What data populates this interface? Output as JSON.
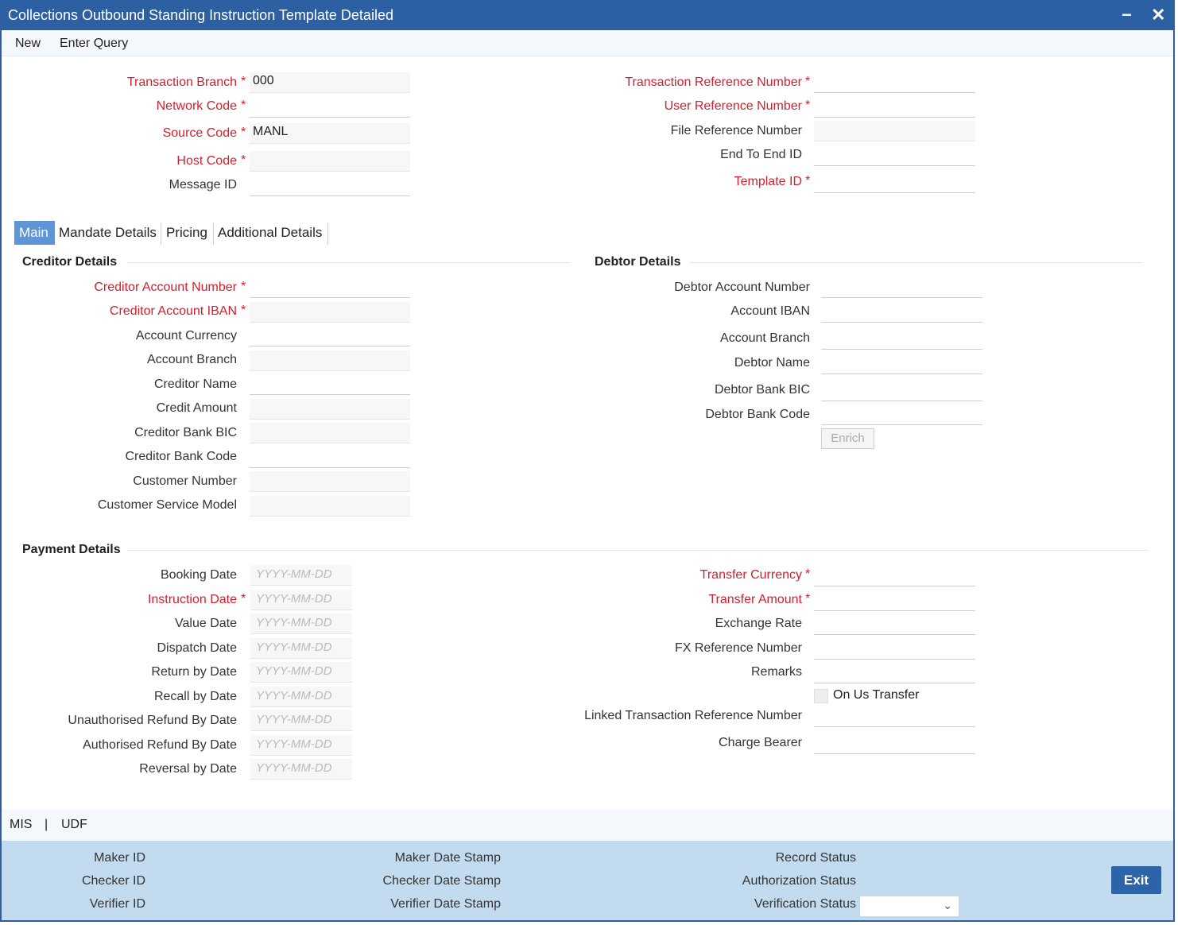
{
  "window": {
    "title": "Collections Outbound Standing Instruction Template Detailed",
    "minimize": "−",
    "close": "✕"
  },
  "toolbar": {
    "new": "New",
    "enter_query": "Enter Query"
  },
  "header": {
    "transaction_branch": {
      "label": "Transaction Branch",
      "value": "000"
    },
    "network_code": {
      "label": "Network Code",
      "value": ""
    },
    "source_code": {
      "label": "Source Code",
      "value": "MANL"
    },
    "host_code": {
      "label": "Host Code",
      "value": ""
    },
    "message_id": {
      "label": "Message ID",
      "value": ""
    },
    "transaction_reference_number": {
      "label": "Transaction Reference Number",
      "value": ""
    },
    "user_reference_number": {
      "label": "User Reference Number",
      "value": ""
    },
    "file_reference_number": {
      "label": "File Reference Number",
      "value": ""
    },
    "end_to_end_id": {
      "label": "End To End ID",
      "value": ""
    },
    "template_id": {
      "label": "Template ID",
      "value": ""
    }
  },
  "required_mark": "*",
  "tabs": {
    "main": "Main",
    "mandate": "Mandate Details",
    "pricing": "Pricing",
    "additional": "Additional Details"
  },
  "creditor": {
    "section_title": "Creditor Details",
    "account_number": "Creditor Account Number",
    "account_iban": "Creditor Account IBAN",
    "account_currency": "Account Currency",
    "account_branch": "Account Branch",
    "name": "Creditor Name",
    "credit_amount": "Credit Amount",
    "bank_bic": "Creditor Bank BIC",
    "bank_code": "Creditor Bank Code",
    "customer_number": "Customer Number",
    "customer_service_model": "Customer Service Model"
  },
  "debtor": {
    "section_title": "Debtor Details",
    "account_number": "Debtor Account Number",
    "account_iban": "Account IBAN",
    "account_branch": "Account Branch",
    "name": "Debtor Name",
    "bank_bic": "Debtor Bank BIC",
    "bank_code": "Debtor Bank Code",
    "enrich": "Enrich"
  },
  "payment": {
    "section_title": "Payment Details",
    "date_placeholder": "YYYY-MM-DD",
    "booking_date": "Booking Date",
    "instruction_date": "Instruction Date",
    "value_date": "Value Date",
    "dispatch_date": "Dispatch Date",
    "return_by_date": "Return by Date",
    "recall_by_date": "Recall by Date",
    "unauthorised_refund_by_date": "Unauthorised Refund By Date",
    "authorised_refund_by_date": "Authorised Refund By Date",
    "reversal_by_date": "Reversal by Date",
    "transfer_currency": "Transfer Currency",
    "transfer_amount": "Transfer Amount",
    "exchange_rate": "Exchange Rate",
    "fx_reference_number": "FX Reference Number",
    "remarks": "Remarks",
    "on_us_transfer": "On Us Transfer",
    "linked_transaction_reference_number": "Linked Transaction Reference Number",
    "charge_bearer": "Charge Bearer"
  },
  "links": {
    "mis": "MIS",
    "separator": "|",
    "udf": "UDF"
  },
  "footer": {
    "maker_id": "Maker ID",
    "checker_id": "Checker ID",
    "verifier_id": "Verifier ID",
    "maker_date_stamp": "Maker Date Stamp",
    "checker_date_stamp": "Checker Date Stamp",
    "verifier_date_stamp": "Verifier Date Stamp",
    "record_status": "Record Status",
    "authorization_status": "Authorization Status",
    "verification_status": "Verification Status",
    "exit": "Exit"
  },
  "colors": {
    "title_bar": "#2d5fa3",
    "required": "#d3202f",
    "tab_active": "#5f95d4",
    "footer_bg": "#c3dbef",
    "exit_button": "#2d63a8"
  },
  "icons": {
    "verification_select": "chevron-down-icon"
  }
}
